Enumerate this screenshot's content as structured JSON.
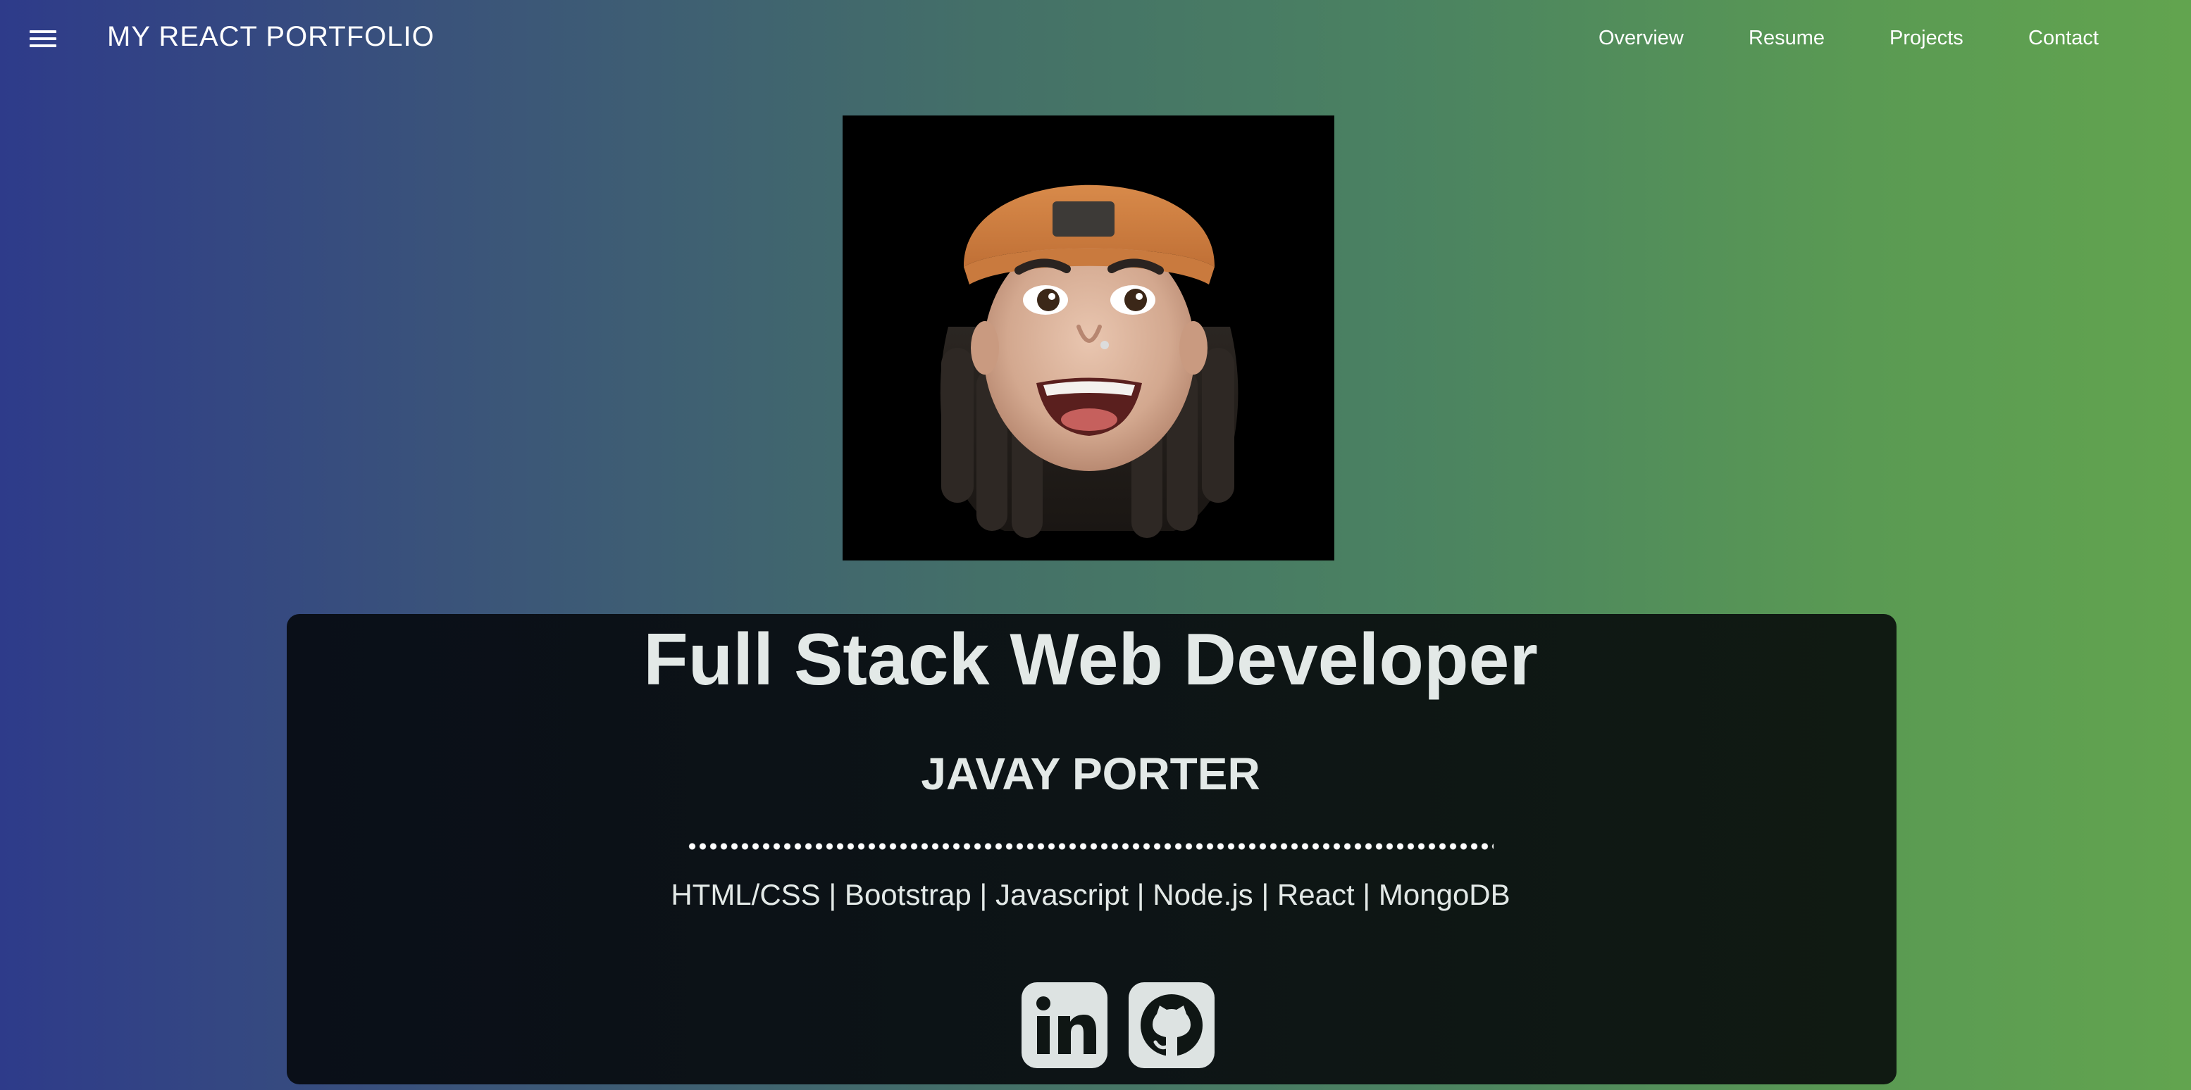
{
  "header": {
    "menu_icon": "hamburger-menu-icon",
    "brand": "MY REACT PORTFOLIO",
    "nav": [
      {
        "label": "Overview"
      },
      {
        "label": "Resume"
      },
      {
        "label": "Projects"
      },
      {
        "label": "Contact"
      }
    ]
  },
  "profile": {
    "avatar_icon": "memoji-avatar",
    "title": "Full Stack Web Developer",
    "name": "JAVAY PORTER",
    "skills": "HTML/CSS | Bootstrap | Javascript | Node.js | React | MongoDB"
  },
  "social": [
    {
      "icon": "linkedin-icon"
    },
    {
      "icon": "github-icon"
    }
  ],
  "colors": {
    "gradient_left": "#2e3b8a",
    "gradient_right": "#62a44f",
    "card_background": "#0d1416",
    "text": "#e3e9e7"
  }
}
